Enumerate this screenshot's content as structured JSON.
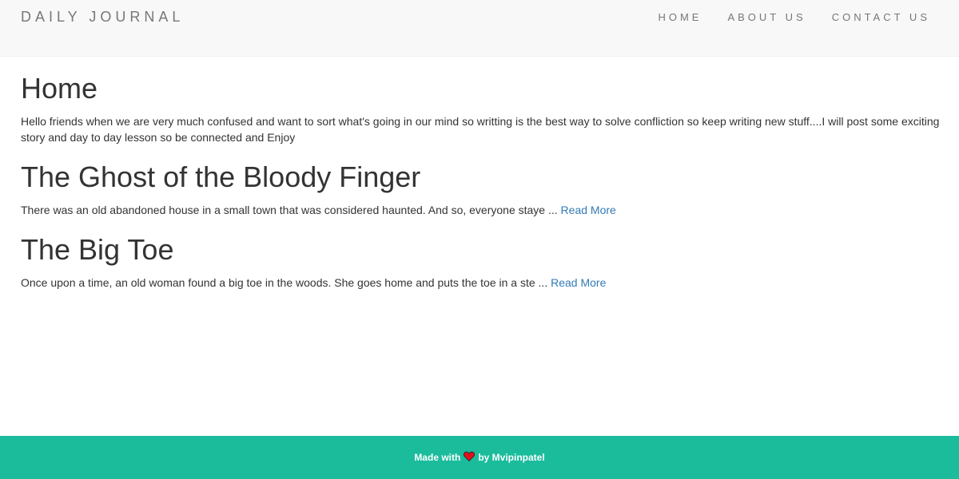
{
  "navbar": {
    "brand": "DAILY JOURNAL",
    "links": [
      {
        "label": "HOME"
      },
      {
        "label": "ABOUT US"
      },
      {
        "label": "CONTACT US"
      }
    ]
  },
  "home": {
    "title": "Home",
    "text": "Hello friends when we are very much confused and want to sort what's going in our mind so writting is the best way to solve confliction so keep writing new stuff....I will post some exciting story and day to day lesson so be connected and Enjoy"
  },
  "posts": [
    {
      "title": "The Ghost of the Bloody Finger",
      "excerpt": "There was an old abandoned house in a small town that was considered haunted. And so, everyone staye ...",
      "read_more": "Read More"
    },
    {
      "title": "The Big Toe",
      "excerpt": "Once upon a time, an old woman found a big toe in the woods. She goes home and puts the toe in a ste ...",
      "read_more": "Read More"
    }
  ],
  "footer": {
    "made_with": "Made with",
    "by": "by Mvipinpatel",
    "heart_icon": "heart-icon",
    "heart_color": "#e0101e"
  },
  "colors": {
    "navbar_bg": "#f8f8f8",
    "footer_bg": "#1abc9c",
    "link": "#337ab7"
  }
}
